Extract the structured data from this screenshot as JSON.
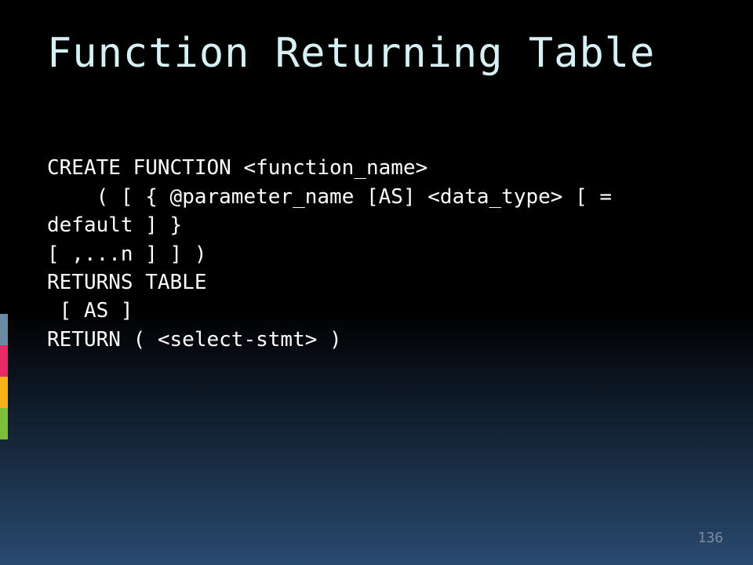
{
  "slide": {
    "title": "Function Returning Table",
    "code_lines": [
      "CREATE FUNCTION <function_name>",
      "    ( [ { @parameter_name [AS] <data_type> [ = default ] }",
      "[ ,...n ] ] )",
      "RETURNS TABLE",
      " [ AS ]",
      "RETURN ( <select-stmt> )"
    ],
    "page_number": "136",
    "accent_colors": [
      "#6b8aa3",
      "#e82a68",
      "#f6b21b",
      "#7cbf3a"
    ]
  }
}
